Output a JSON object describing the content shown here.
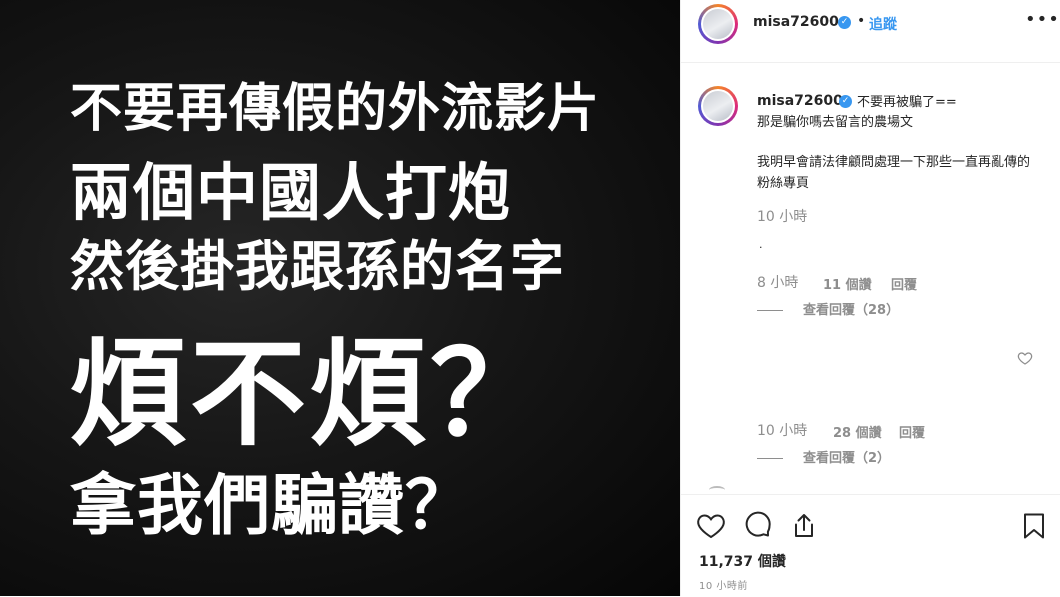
{
  "image": {
    "lines": [
      "不要再傳假的外流影片",
      "兩個中國人打炮",
      "然後掛我跟孫的名字",
      "煩不煩？",
      "拿我們騙讚？"
    ]
  },
  "header": {
    "username": "misa72600",
    "separator": "•",
    "follow_label": "追蹤",
    "more_label": "•••"
  },
  "caption": {
    "username": "misa72600",
    "line1": "不要再被騙了==",
    "line2": "那是騙你嗎去留言的農場文",
    "line3": "我明早會請法律顧問處理一下那些一直再亂傳的粉絲專頁",
    "time": "10 小時",
    "dot": "."
  },
  "comments": [
    {
      "time": "8 小時",
      "likes": "11 個讚",
      "reply": "回覆",
      "view_replies": "查看回覆（28）"
    },
    {
      "time": "10 小時",
      "likes": "28 個讚",
      "reply": "回覆",
      "view_replies": "查看回覆（2）"
    }
  ],
  "actions": {
    "likes_count": "11,737 個讚",
    "posted_time": "10 小時前"
  },
  "colors": {
    "accent": "#3897f0",
    "text": "#262626",
    "muted": "#8e8e8e"
  }
}
